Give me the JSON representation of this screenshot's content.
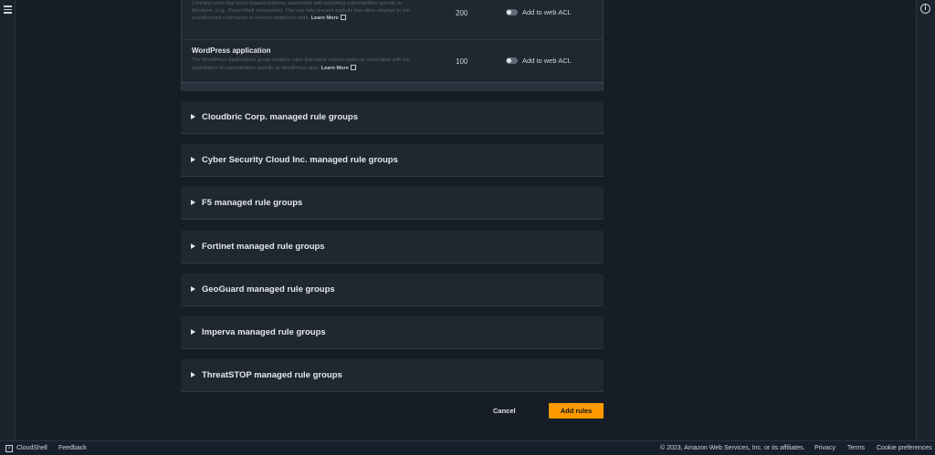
{
  "rules": [
    {
      "name": "",
      "description": "Contains rules that block request patterns associated with exploiting vulnerabilities specific to Windows, (e.g., PowerShell commands). This can help prevent exploits that allow attacker to run unauthorized commands or execute malicious code.",
      "learn_more": "Learn More",
      "capacity": "200",
      "toggle_label": "Add to web ACL"
    },
    {
      "name": "WordPress application",
      "description": "The WordPress Applications group contains rules that block request patterns associated with the exploitation of vulnerabilities specific to WordPress sites.",
      "learn_more": "Learn More",
      "capacity": "100",
      "toggle_label": "Add to web ACL"
    }
  ],
  "groups": [
    "Cloudbric Corp. managed rule groups",
    "Cyber Security Cloud Inc. managed rule groups",
    "F5 managed rule groups",
    "Fortinet managed rule groups",
    "GeoGuard managed rule groups",
    "Imperva managed rule groups",
    "ThreatSTOP managed rule groups"
  ],
  "actions": {
    "cancel": "Cancel",
    "add_rules": "Add rules"
  },
  "footer": {
    "cloudshell": "CloudShell",
    "feedback": "Feedback",
    "copyright": "© 2023, Amazon Web Services, Inc. or its affiliates.",
    "privacy": "Privacy",
    "terms": "Terms",
    "cookie": "Cookie preferences"
  },
  "colors": {
    "accent": "#ff9900",
    "background": "#161d26",
    "panel": "#1f2730"
  },
  "icons": [
    "menu-icon",
    "info-icon",
    "caret-right-icon",
    "external-link-icon",
    "cloudshell-icon"
  ]
}
